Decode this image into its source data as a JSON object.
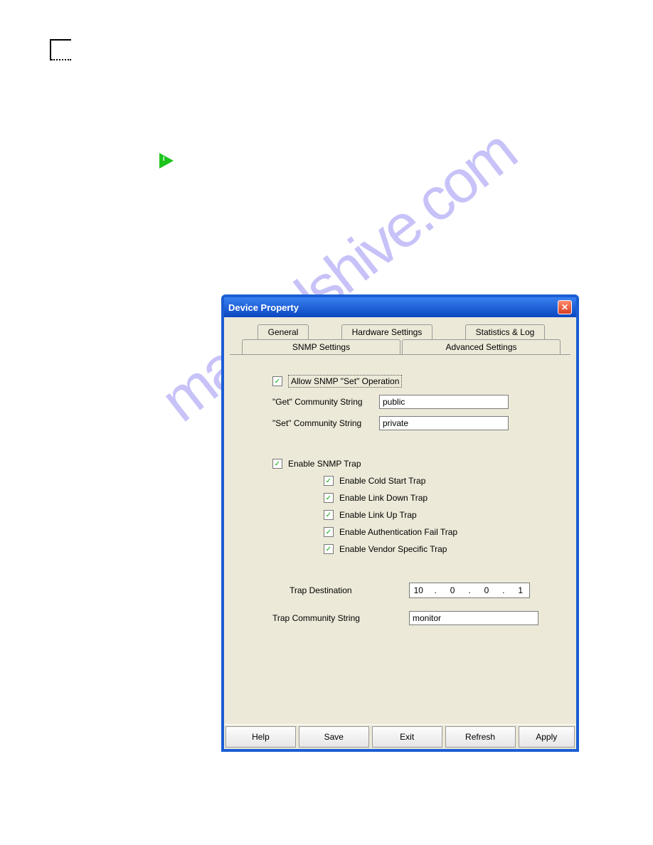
{
  "watermark": "manualshive.com",
  "window": {
    "title": "Device Property",
    "tabs_row1": [
      "General",
      "Hardware Settings",
      "Statistics & Log"
    ],
    "tabs_row2": [
      "SNMP Settings",
      "Advanced Settings"
    ],
    "snmp": {
      "allow_set_label": "Allow SNMP \"Set\" Operation",
      "allow_set_checked": true,
      "get_community_label": "\"Get\" Community String",
      "get_community_value": "public",
      "set_community_label": "\"Set\" Community String",
      "set_community_value": "private",
      "enable_trap_label": "Enable SNMP Trap",
      "enable_trap_checked": true,
      "traps": [
        {
          "label": "Enable Cold Start Trap",
          "checked": true
        },
        {
          "label": "Enable Link Down Trap",
          "checked": true
        },
        {
          "label": "Enable Link Up Trap",
          "checked": true
        },
        {
          "label": "Enable Authentication Fail Trap",
          "checked": true
        },
        {
          "label": "Enable Vendor Specific Trap",
          "checked": true
        }
      ],
      "trap_dest_label": "Trap Destination",
      "trap_dest_ip": [
        "10",
        "0",
        "0",
        "1"
      ],
      "trap_community_label": "Trap Community String",
      "trap_community_value": "monitor"
    },
    "buttons": [
      "Help",
      "Save",
      "Exit",
      "Refresh",
      "Apply"
    ]
  }
}
